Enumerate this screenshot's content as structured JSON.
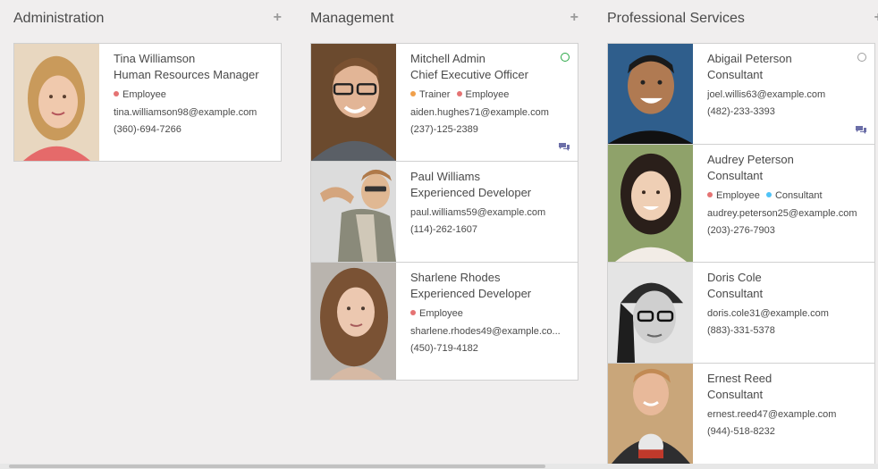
{
  "columns": [
    {
      "title": "Administration",
      "add_icon": "+",
      "cards": [
        {
          "name": "Tina Williamson",
          "job": "Human Resources Manager",
          "tags": [
            {
              "label": "Employee",
              "color": "#e57373"
            }
          ],
          "email": "tina.williamson98@example.com",
          "phone": "(360)-694-7266",
          "photo_icon": "woman-portrait-photo"
        }
      ]
    },
    {
      "title": "Management",
      "add_icon": "+",
      "cards": [
        {
          "name": "Mitchell Admin",
          "job": "Chief Executive Officer",
          "tags": [
            {
              "label": "Trainer",
              "color": "#f0a04b"
            },
            {
              "label": "Employee",
              "color": "#e57373"
            }
          ],
          "email": "aiden.hughes71@example.com",
          "phone": "(237)-125-2389",
          "status": "online",
          "status_color": "#28a745",
          "chat_icon": "chat-icon",
          "photo_icon": "man-glasses-portrait-photo"
        },
        {
          "name": "Paul Williams",
          "job": "Experienced Developer",
          "tags": [],
          "email": "paul.williams59@example.com",
          "phone": "(114)-262-1607",
          "photo_icon": "man-plaid-shirt-photo"
        },
        {
          "name": "Sharlene Rhodes",
          "job": "Experienced Developer",
          "tags": [
            {
              "label": "Employee",
              "color": "#e57373"
            }
          ],
          "email": "sharlene.rhodes49@example.co...",
          "phone": "(450)-719-4182",
          "photo_icon": "woman-curly-hair-photo"
        }
      ]
    },
    {
      "title": "Professional Services",
      "add_icon": "+",
      "cards": [
        {
          "name": "Abigail Peterson",
          "job": "Consultant",
          "tags": [],
          "email": "joel.willis63@example.com",
          "phone": "(482)-233-3393",
          "status": "offline",
          "status_color": "#9e9e9e",
          "chat_icon": "chat-icon",
          "photo_icon": "man-smiling-photo"
        },
        {
          "name": "Audrey Peterson",
          "job": "Consultant",
          "tags": [
            {
              "label": "Employee",
              "color": "#e57373"
            },
            {
              "label": "Consultant",
              "color": "#4fc3f7"
            }
          ],
          "email": "audrey.peterson25@example.com",
          "phone": "(203)-276-7903",
          "photo_icon": "woman-smiling-photo"
        },
        {
          "name": "Doris Cole",
          "job": "Consultant",
          "tags": [],
          "email": "doris.cole31@example.com",
          "phone": "(883)-331-5378",
          "photo_icon": "woman-beanie-glasses-photo"
        },
        {
          "name": "Ernest Reed",
          "job": "Consultant",
          "tags": [],
          "email": "ernest.reed47@example.com",
          "phone": "(944)-518-8232",
          "photo_icon": "man-tshirt-photo"
        }
      ]
    }
  ]
}
